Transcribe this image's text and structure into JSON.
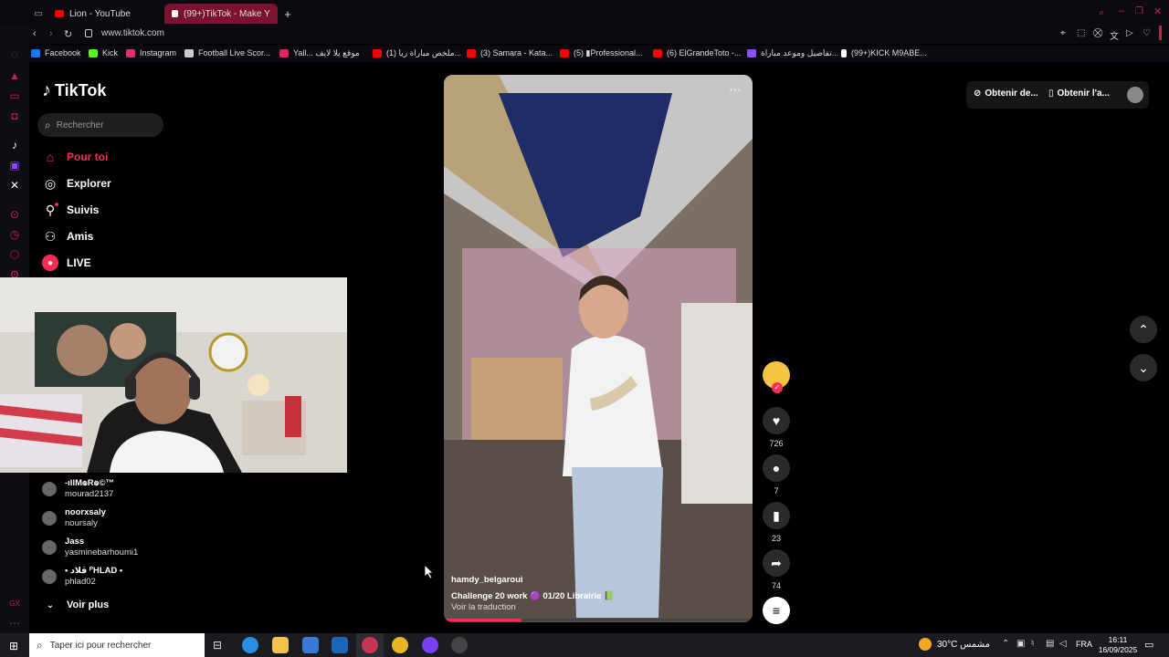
{
  "browser": {
    "tabs": [
      {
        "title": "Lion - YouTube",
        "favicon_color": "#ff0000",
        "active": false
      },
      {
        "title": "(99+)TikTok - Make Y",
        "favicon_color": "#ffffff",
        "active": true
      }
    ],
    "new_tab": "+",
    "url": "www.tiktok.com",
    "bookmarks": [
      {
        "label": "Facebook",
        "color": "#1877f2"
      },
      {
        "label": "Kick",
        "color": "#53fc18"
      },
      {
        "label": "Instagram",
        "color": "#e1306c"
      },
      {
        "label": "Football Live Scor...",
        "color": "#cccccc"
      },
      {
        "label": "Yall... موقع يلا لايف",
        "color": "#e0245e"
      },
      {
        "label": "(1) ملخص مباراة ريا...",
        "color": "#ff0000"
      },
      {
        "label": "(3) Samara - Kata...",
        "color": "#ff0000"
      },
      {
        "label": "(5) ▮Professional...",
        "color": "#ff0000"
      },
      {
        "label": "(6) ElGrandeToto -...",
        "color": "#ff0000"
      },
      {
        "label": "تفاصيل وموعد مباراة...",
        "color": "#8a4fff"
      },
      {
        "label": "(99+)KICK M9ABE...",
        "color": "#ffffff"
      }
    ]
  },
  "tiktok": {
    "logo": "TikTok",
    "search_placeholder": "Rechercher",
    "nav": [
      {
        "label": "Pour toi",
        "icon": "home-icon",
        "active": true
      },
      {
        "label": "Explorer",
        "icon": "compass-icon",
        "active": false
      },
      {
        "label": "Suivis",
        "icon": "following-icon",
        "active": false
      },
      {
        "label": "Amis",
        "icon": "friends-icon",
        "active": false
      },
      {
        "label": "LIVE",
        "icon": "live-icon",
        "active": false
      }
    ],
    "following": [
      {
        "name": "-ıllM๏R๏©™",
        "username": "mourad2137"
      },
      {
        "name": "noorxsaly",
        "username": "noursaly"
      },
      {
        "name": "Jass",
        "username": "yasminebarhoumi1"
      },
      {
        "name": "• ڤلاد ᴾHLAD •",
        "username": "phlad02"
      }
    ],
    "see_more": "Voir plus",
    "top_buttons": {
      "coins": "Obtenir de...",
      "app": "Obtenir l'a..."
    },
    "video": {
      "author": "hamdy_belgaroui",
      "caption": "Challenge 20 work 🟣 01/20 Librairie 📗",
      "translate": "Voir la traduction",
      "progress": 0.25
    },
    "actions": {
      "likes": "726",
      "comments": "7",
      "saves": "23",
      "shares": "74"
    },
    "accent": "#fe2c55"
  },
  "taskbar": {
    "search_placeholder": "Taper ici pour rechercher",
    "weather": "30°C  مشمس",
    "language": "FRA",
    "time": "16:11",
    "date": "16/09/2025"
  }
}
